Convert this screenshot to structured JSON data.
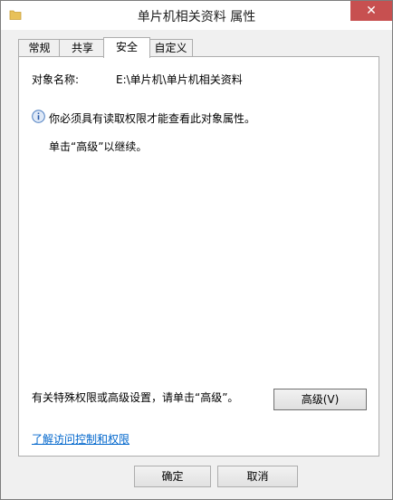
{
  "window": {
    "title": "单片机相关资料 属性",
    "close_label": "✕"
  },
  "tabs": [
    {
      "label": "常规"
    },
    {
      "label": "共享"
    },
    {
      "label": "安全",
      "active": true
    },
    {
      "label": "自定义"
    }
  ],
  "security": {
    "object_name_label": "对象名称:",
    "object_name_value": "E:\\单片机\\单片机相关资料",
    "info_message": "你必须具有读取权限才能查看此对象属性。",
    "continue_message": "单击“高级”以继续。",
    "special_permissions_text": "有关特殊权限或高级设置，请单击“高级”。",
    "advanced_button": "高级(V)",
    "learn_link": "了解访问控制和权限"
  },
  "footer": {
    "ok_label": "确定",
    "cancel_label": "取消"
  },
  "colors": {
    "close_button": "#c75050",
    "link": "#0066cc",
    "folder_icon": "#e8c15a"
  }
}
